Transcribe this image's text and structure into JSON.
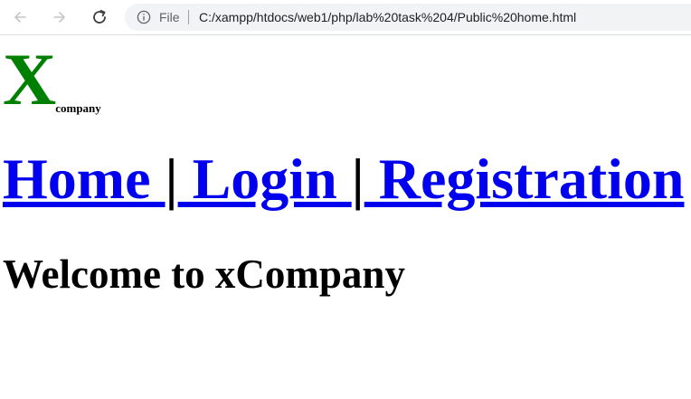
{
  "browser": {
    "file_label": "File",
    "url": "C:/xampp/htdocs/web1/php/lab%20task%204/Public%20home.html"
  },
  "page": {
    "logo_letter": "X",
    "logo_sub": "company",
    "nav": [
      {
        "label": "Home "
      },
      {
        "label": " Login "
      },
      {
        "label": " Registration"
      }
    ],
    "separator": "|",
    "welcome": "Welcome to xCompany"
  },
  "colors": {
    "logo": "#008000",
    "link": "#0000ee"
  }
}
